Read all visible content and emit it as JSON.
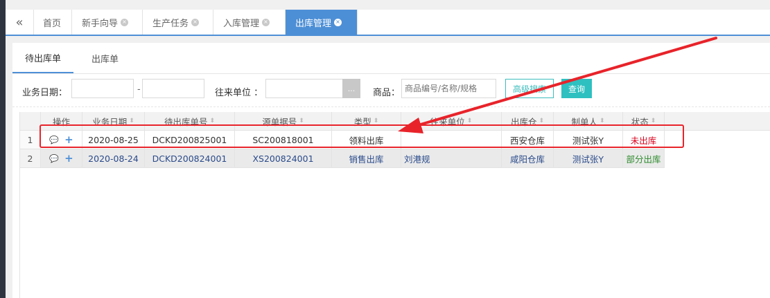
{
  "tabbar": {
    "collapse_icon": "«",
    "tabs": [
      {
        "label": "首页",
        "closable": false,
        "active": false
      },
      {
        "label": "新手向导",
        "closable": true,
        "active": false
      },
      {
        "label": "生产任务",
        "closable": true,
        "active": false
      },
      {
        "label": "入库管理",
        "closable": true,
        "active": false
      },
      {
        "label": "出库管理",
        "closable": true,
        "active": true
      }
    ],
    "close_glyph": "×"
  },
  "subtabs": [
    {
      "label": "待出库单",
      "active": true
    },
    {
      "label": "出库单",
      "active": false
    }
  ],
  "filters": {
    "business_date_label": "业务日期：",
    "date_from": "",
    "date_sep": "-",
    "date_to": "",
    "partner_label": "往来单位 ：",
    "partner_value": "",
    "partner_picker": "...",
    "product_label": "商品：",
    "product_placeholder": "商品编号/名称/规格",
    "advanced_search": "高级搜索",
    "query": "查询"
  },
  "grid": {
    "sort_glyph": "⬍",
    "columns": [
      "操作",
      "业务日期",
      "待出库单号",
      "源单据号",
      "类型",
      "往来单位",
      "出库仓",
      "制单人",
      "状态"
    ],
    "rows": [
      {
        "num": "1",
        "date": "2020-08-25",
        "pending_no": "DCKD200825001",
        "source_no": "SC200818001",
        "type": "领料出库",
        "partner": "",
        "warehouse": "西安仓库",
        "creator": "测试张Y",
        "status": "未出库"
      },
      {
        "num": "2",
        "date": "2020-08-24",
        "pending_no": "DCKD200824001",
        "source_no": "XS200824001",
        "type": "销售出库",
        "partner": "刘港规",
        "warehouse": "咸阳仓库",
        "creator": "测试张Y",
        "status": "部分出库"
      }
    ]
  },
  "colors": {
    "accent": "#4d8fd6",
    "teal": "#2ec0c0",
    "annotation_red": "#e8232a",
    "status_none": "#d9001b",
    "status_partial": "#2e8b2e"
  }
}
